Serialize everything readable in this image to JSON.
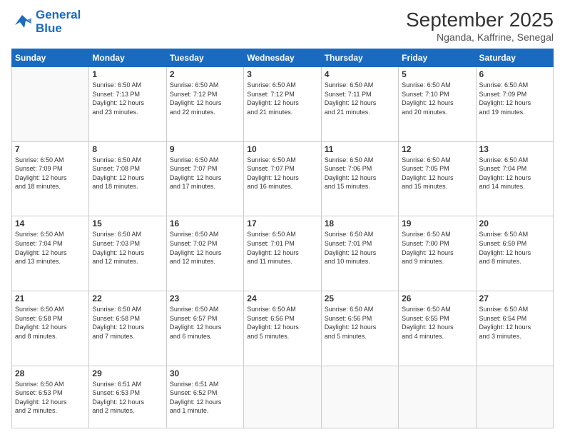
{
  "logo": {
    "line1": "General",
    "line2": "Blue"
  },
  "title": "September 2025",
  "subtitle": "Nganda, Kaffrine, Senegal",
  "weekdays": [
    "Sunday",
    "Monday",
    "Tuesday",
    "Wednesday",
    "Thursday",
    "Friday",
    "Saturday"
  ],
  "weeks": [
    [
      {
        "day": "",
        "info": ""
      },
      {
        "day": "1",
        "info": "Sunrise: 6:50 AM\nSunset: 7:13 PM\nDaylight: 12 hours\nand 23 minutes."
      },
      {
        "day": "2",
        "info": "Sunrise: 6:50 AM\nSunset: 7:12 PM\nDaylight: 12 hours\nand 22 minutes."
      },
      {
        "day": "3",
        "info": "Sunrise: 6:50 AM\nSunset: 7:12 PM\nDaylight: 12 hours\nand 21 minutes."
      },
      {
        "day": "4",
        "info": "Sunrise: 6:50 AM\nSunset: 7:11 PM\nDaylight: 12 hours\nand 21 minutes."
      },
      {
        "day": "5",
        "info": "Sunrise: 6:50 AM\nSunset: 7:10 PM\nDaylight: 12 hours\nand 20 minutes."
      },
      {
        "day": "6",
        "info": "Sunrise: 6:50 AM\nSunset: 7:09 PM\nDaylight: 12 hours\nand 19 minutes."
      }
    ],
    [
      {
        "day": "7",
        "info": "Sunrise: 6:50 AM\nSunset: 7:09 PM\nDaylight: 12 hours\nand 18 minutes."
      },
      {
        "day": "8",
        "info": "Sunrise: 6:50 AM\nSunset: 7:08 PM\nDaylight: 12 hours\nand 18 minutes."
      },
      {
        "day": "9",
        "info": "Sunrise: 6:50 AM\nSunset: 7:07 PM\nDaylight: 12 hours\nand 17 minutes."
      },
      {
        "day": "10",
        "info": "Sunrise: 6:50 AM\nSunset: 7:07 PM\nDaylight: 12 hours\nand 16 minutes."
      },
      {
        "day": "11",
        "info": "Sunrise: 6:50 AM\nSunset: 7:06 PM\nDaylight: 12 hours\nand 15 minutes."
      },
      {
        "day": "12",
        "info": "Sunrise: 6:50 AM\nSunset: 7:05 PM\nDaylight: 12 hours\nand 15 minutes."
      },
      {
        "day": "13",
        "info": "Sunrise: 6:50 AM\nSunset: 7:04 PM\nDaylight: 12 hours\nand 14 minutes."
      }
    ],
    [
      {
        "day": "14",
        "info": "Sunrise: 6:50 AM\nSunset: 7:04 PM\nDaylight: 12 hours\nand 13 minutes."
      },
      {
        "day": "15",
        "info": "Sunrise: 6:50 AM\nSunset: 7:03 PM\nDaylight: 12 hours\nand 12 minutes."
      },
      {
        "day": "16",
        "info": "Sunrise: 6:50 AM\nSunset: 7:02 PM\nDaylight: 12 hours\nand 12 minutes."
      },
      {
        "day": "17",
        "info": "Sunrise: 6:50 AM\nSunset: 7:01 PM\nDaylight: 12 hours\nand 11 minutes."
      },
      {
        "day": "18",
        "info": "Sunrise: 6:50 AM\nSunset: 7:01 PM\nDaylight: 12 hours\nand 10 minutes."
      },
      {
        "day": "19",
        "info": "Sunrise: 6:50 AM\nSunset: 7:00 PM\nDaylight: 12 hours\nand 9 minutes."
      },
      {
        "day": "20",
        "info": "Sunrise: 6:50 AM\nSunset: 6:59 PM\nDaylight: 12 hours\nand 8 minutes."
      }
    ],
    [
      {
        "day": "21",
        "info": "Sunrise: 6:50 AM\nSunset: 6:58 PM\nDaylight: 12 hours\nand 8 minutes."
      },
      {
        "day": "22",
        "info": "Sunrise: 6:50 AM\nSunset: 6:58 PM\nDaylight: 12 hours\nand 7 minutes."
      },
      {
        "day": "23",
        "info": "Sunrise: 6:50 AM\nSunset: 6:57 PM\nDaylight: 12 hours\nand 6 minutes."
      },
      {
        "day": "24",
        "info": "Sunrise: 6:50 AM\nSunset: 6:56 PM\nDaylight: 12 hours\nand 5 minutes."
      },
      {
        "day": "25",
        "info": "Sunrise: 6:50 AM\nSunset: 6:56 PM\nDaylight: 12 hours\nand 5 minutes."
      },
      {
        "day": "26",
        "info": "Sunrise: 6:50 AM\nSunset: 6:55 PM\nDaylight: 12 hours\nand 4 minutes."
      },
      {
        "day": "27",
        "info": "Sunrise: 6:50 AM\nSunset: 6:54 PM\nDaylight: 12 hours\nand 3 minutes."
      }
    ],
    [
      {
        "day": "28",
        "info": "Sunrise: 6:50 AM\nSunset: 6:53 PM\nDaylight: 12 hours\nand 2 minutes."
      },
      {
        "day": "29",
        "info": "Sunrise: 6:51 AM\nSunset: 6:53 PM\nDaylight: 12 hours\nand 2 minutes."
      },
      {
        "day": "30",
        "info": "Sunrise: 6:51 AM\nSunset: 6:52 PM\nDaylight: 12 hours\nand 1 minute."
      },
      {
        "day": "",
        "info": ""
      },
      {
        "day": "",
        "info": ""
      },
      {
        "day": "",
        "info": ""
      },
      {
        "day": "",
        "info": ""
      }
    ]
  ]
}
